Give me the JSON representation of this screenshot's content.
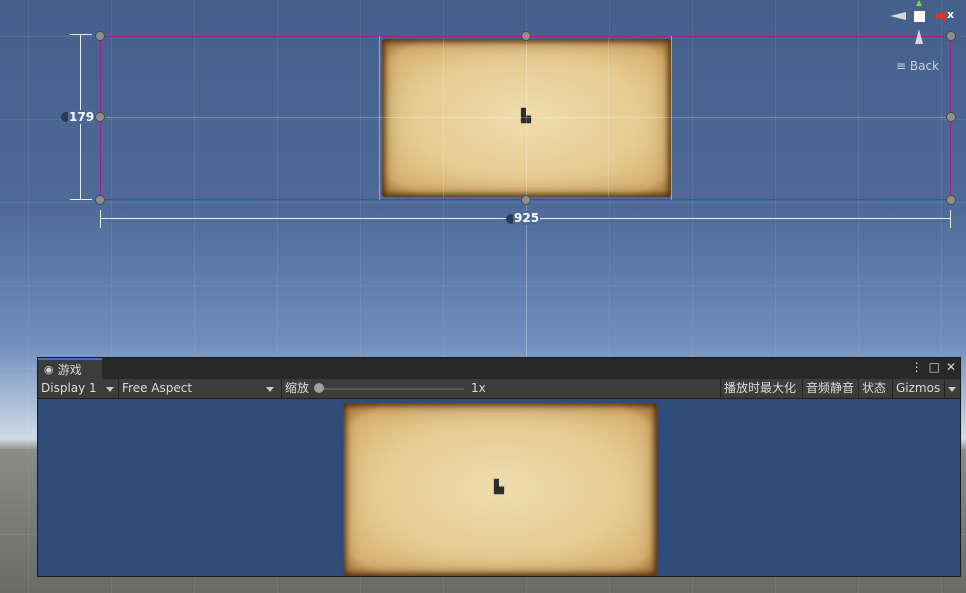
{
  "scene": {
    "height_dimension": "179",
    "width_dimension": "925",
    "gizmo": {
      "axis_label": "x",
      "back_label": "Back"
    }
  },
  "game_panel": {
    "tab_label": "游戏",
    "toolbar": {
      "display": "Display 1",
      "aspect": "Free Aspect",
      "scale_label": "缩放",
      "scale_value": "1x",
      "maximize_on_play": "播放时最大化",
      "mute_audio": "音频静音",
      "stats": "状态",
      "gizmos": "Gizmos"
    },
    "window_buttons": {
      "menu": "⋮",
      "maximize": "□",
      "close": "✕"
    }
  },
  "colors": {
    "selection_outline": "#a0208e",
    "ui_rect_outline": "#4fc3f7",
    "game_background": "#2f4d78",
    "tab_accent": "#3a79bb"
  }
}
